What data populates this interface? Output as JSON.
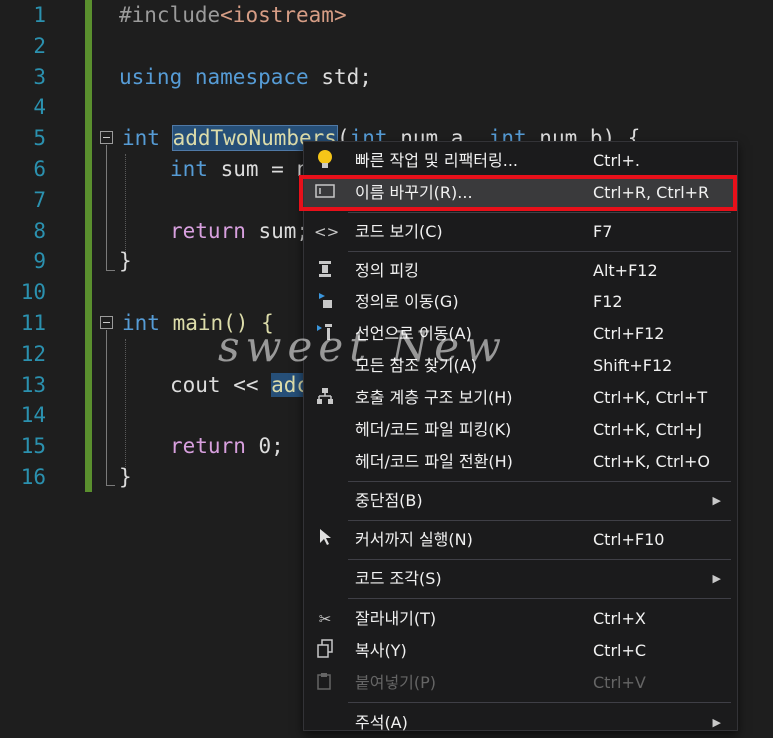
{
  "editor": {
    "line_numbers": [
      "1",
      "2",
      "3",
      "4",
      "5",
      "6",
      "7",
      "8",
      "9",
      "10",
      "11",
      "12",
      "13",
      "14",
      "15",
      "16"
    ],
    "lines": {
      "l1_pp": "#include",
      "l1_str": "<iostream>",
      "l3_using": "using",
      "l3_namespace": "namespace",
      "l3_std": " std;",
      "l5_int": "int",
      "l5_fn": "addTwoNumbers",
      "l5_rest_a": "(",
      "l5_int2": "int",
      "l5_rest_b": " num_a, ",
      "l5_int3": "int",
      "l5_rest_c": " num_b) {",
      "l6_int": "int",
      "l6_rest": " sum = n",
      "l8_return": "return",
      "l8_rest": " sum;",
      "l9": "}",
      "l11_int": "int",
      "l11_main": " main() {",
      "l13_cout": "cout << ",
      "l13_hl": "adc",
      "l15_return": "return",
      "l15_rest": " 0;",
      "l16": "}"
    }
  },
  "context_menu": {
    "items": [
      {
        "icon": "lightbulb-icon",
        "label": "빠른 작업 및 리팩터링...",
        "shortcut": "Ctrl+."
      },
      {
        "icon": "rename-icon",
        "label": "이름 바꾸기(R)...",
        "shortcut": "Ctrl+R, Ctrl+R"
      },
      {
        "icon": "code-view-icon",
        "label": "코드 보기(C)",
        "shortcut": "F7"
      },
      {
        "icon": "peek-definition-icon",
        "label": "정의 피킹",
        "shortcut": "Alt+F12"
      },
      {
        "icon": "go-to-definition-icon",
        "label": "정의로 이동(G)",
        "shortcut": "F12"
      },
      {
        "icon": "go-to-declaration-icon",
        "label": "선언으로 이동(A)",
        "shortcut": "Ctrl+F12"
      },
      {
        "icon": "",
        "label": "모든 참조 찾기(A)",
        "shortcut": "Shift+F12"
      },
      {
        "icon": "call-hierarchy-icon",
        "label": "호출 계층 구조 보기(H)",
        "shortcut": "Ctrl+K, Ctrl+T"
      },
      {
        "icon": "",
        "label": "헤더/코드 파일 피킹(K)",
        "shortcut": "Ctrl+K, Ctrl+J"
      },
      {
        "icon": "",
        "label": "헤더/코드 파일 전환(H)",
        "shortcut": "Ctrl+K, Ctrl+O"
      },
      {
        "icon": "",
        "label": "중단점(B)",
        "shortcut": ""
      },
      {
        "icon": "cursor-run-icon",
        "label": "커서까지 실행(N)",
        "shortcut": "Ctrl+F10"
      },
      {
        "icon": "",
        "label": "코드 조각(S)",
        "shortcut": ""
      },
      {
        "icon": "cut-icon",
        "label": "잘라내기(T)",
        "shortcut": "Ctrl+X"
      },
      {
        "icon": "copy-icon",
        "label": "복사(Y)",
        "shortcut": "Ctrl+C"
      },
      {
        "icon": "paste-icon",
        "label": "붙여넣기(P)",
        "shortcut": "Ctrl+V"
      },
      {
        "icon": "",
        "label": "주석(A)",
        "shortcut": ""
      }
    ]
  },
  "watermark": "sweet New",
  "colors": {
    "highlight_box": "#e8101a",
    "gutter_change_bar": "#5a8f2e"
  }
}
